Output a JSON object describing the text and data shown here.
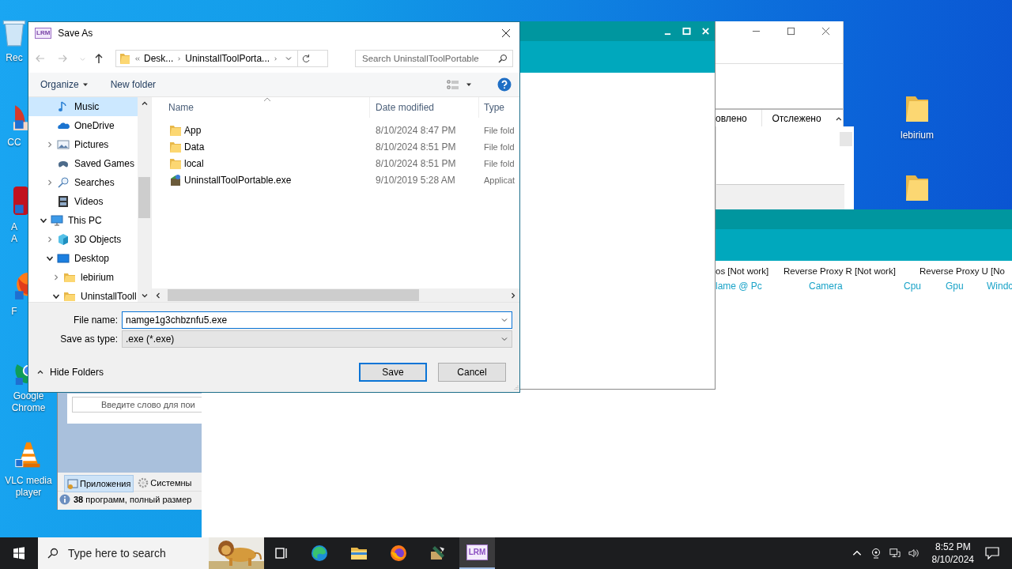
{
  "desktop": {
    "left_icons_partial": [
      {
        "lines": [
          "Rec"
        ],
        "kind": "bin"
      },
      {
        "lines": [
          "CC"
        ],
        "kind": "brush"
      },
      {
        "lines": [
          "A",
          "A"
        ],
        "kind": "acrobat"
      },
      {
        "lines": [
          "F"
        ],
        "kind": "fox"
      }
    ],
    "left_icons": [
      {
        "lines": [
          "Google",
          "Chrome"
        ],
        "kind": "chrome"
      },
      {
        "lines": [
          "VLC media",
          "player"
        ],
        "kind": "vlc"
      }
    ],
    "right_icons": [
      {
        "label": "lebirium"
      }
    ]
  },
  "list_window": {
    "columns": [
      "овлено",
      "Отслежено"
    ]
  },
  "proxy_window": {
    "row_1": [
      "os [Not work]",
      "Reverse Proxy R [Not work]",
      "Reverse Proxy U [No"
    ],
    "row_2": [
      "lame @ Pc",
      "Camera",
      "Cpu",
      "Gpu",
      "Windc"
    ]
  },
  "uninstaller": {
    "search_placeholder": "Введите слово для пои",
    "tabs": [
      {
        "label": "Приложения",
        "selected": true
      },
      {
        "label": "Системны",
        "selected": false
      }
    ],
    "status": "**38** программ, полный размер"
  },
  "dialog": {
    "app_badge": "LRM",
    "title": "Save As",
    "address": {
      "crumbs": [
        "Desk...",
        "UninstallToolPorta..."
      ]
    },
    "search": {
      "placeholder": "Search UninstallToolPortable"
    },
    "toolbar": {
      "organize": "Organize",
      "new_folder": "New folder"
    },
    "nav_tree": {
      "scrolled_children": [
        {
          "label": "Music",
          "kind": "music",
          "has_children": false,
          "selected": true
        },
        {
          "label": "OneDrive",
          "kind": "cloud",
          "has_children": false,
          "selected": false
        },
        {
          "label": "Pictures",
          "kind": "pictures",
          "has_children": true,
          "expanded": false,
          "selected": false
        },
        {
          "label": "Saved Games",
          "kind": "games",
          "has_children": false,
          "selected": false
        },
        {
          "label": "Searches",
          "kind": "search",
          "has_children": true,
          "expanded": false,
          "selected": false
        },
        {
          "label": "Videos",
          "kind": "video",
          "has_children": false,
          "selected": false
        }
      ],
      "items": [
        {
          "label": "This PC",
          "kind": "pc",
          "has_children": true,
          "expanded": true,
          "selected": false,
          "children": [
            {
              "label": "3D Objects",
              "kind": "cube",
              "has_children": true,
              "expanded": false,
              "selected": false
            },
            {
              "label": "Desktop",
              "kind": "desktop",
              "has_children": true,
              "expanded": true,
              "selected": false,
              "children": [
                {
                  "label": "lebirium",
                  "kind": "folder",
                  "has_children": true,
                  "expanded": false,
                  "selected": false
                },
                {
                  "label": "UninstallTooll",
                  "kind": "folder",
                  "has_children": true,
                  "expanded": true,
                  "selected": false
                }
              ]
            }
          ]
        }
      ]
    },
    "columns": [
      "Name",
      "Date modified",
      "Type"
    ],
    "files": [
      {
        "name": "App",
        "date": "8/10/2024 8:47 PM",
        "type": "File fold",
        "kind": "folder"
      },
      {
        "name": "Data",
        "date": "8/10/2024 8:51 PM",
        "type": "File fold",
        "kind": "folder"
      },
      {
        "name": "local",
        "date": "8/10/2024 8:51 PM",
        "type": "File fold",
        "kind": "folder"
      },
      {
        "name": "UninstallToolPortable.exe",
        "date": "9/10/2019 5:28 AM",
        "type": "Applicat",
        "kind": "app"
      }
    ],
    "file_name": {
      "label": "File name:",
      "value": "namge1g3chbznfu5.exe"
    },
    "save_as_type": {
      "label": "Save as type:",
      "value": ".exe (*.exe)"
    },
    "hide_folders": "Hide Folders",
    "buttons": [
      {
        "label": "Save",
        "default": true
      },
      {
        "label": "Cancel",
        "default": false
      }
    ]
  },
  "taskbar": {
    "search_placeholder": "Type here to search",
    "apps": [
      {
        "kind": "edge",
        "active": false
      },
      {
        "kind": "explorer",
        "active": false
      },
      {
        "kind": "firefox",
        "active": false
      },
      {
        "kind": "tool",
        "active": false
      },
      {
        "kind": "lrm",
        "label": "LRM",
        "active": true
      }
    ],
    "time": "8:52 PM",
    "date": "8/10/2024"
  }
}
